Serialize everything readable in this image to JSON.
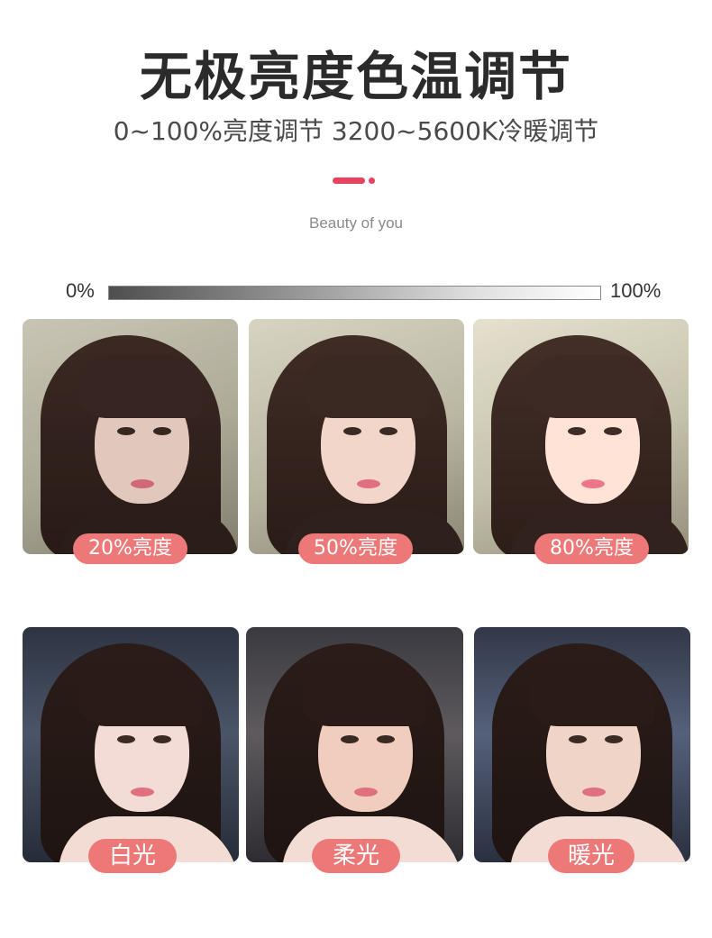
{
  "header": {
    "title": "无极亮度色温调节",
    "subtitle": "0~100%亮度调节 3200~5600K冷暖调节",
    "tagline": "Beauty of you",
    "accent_color": "#e8435e"
  },
  "brightness_scale": {
    "min_label": "0%",
    "max_label": "100%"
  },
  "brightness_examples": [
    {
      "label": "20%亮度",
      "brightness": 20
    },
    {
      "label": "50%亮度",
      "brightness": 50
    },
    {
      "label": "80%亮度",
      "brightness": 80
    }
  ],
  "color_temperature_examples": [
    {
      "label": "白光"
    },
    {
      "label": "柔光"
    },
    {
      "label": "暖光"
    }
  ],
  "label_color": "#ed7878"
}
